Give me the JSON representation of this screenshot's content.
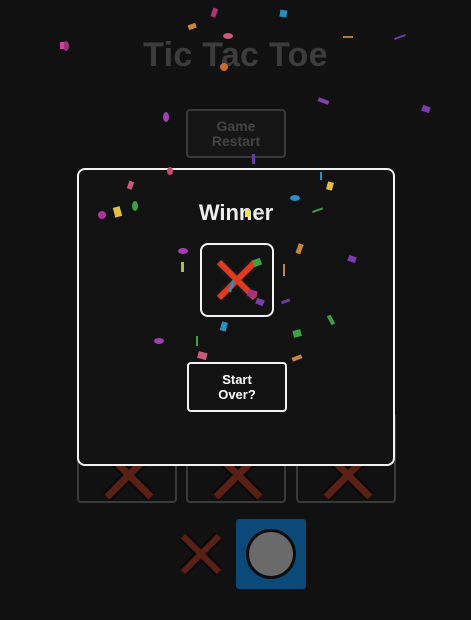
{
  "game": {
    "title": "Tic Tac Toe",
    "restart_label": "Game Restart",
    "board_bottom_row": [
      "X",
      "X",
      "X"
    ],
    "turn_indicator": {
      "x_icon": "x-mark-icon",
      "o_icon": "o-circle-icon",
      "active": "O"
    }
  },
  "modal": {
    "winner_label": "Winner",
    "winner_symbol": "X",
    "winner_icon": "x-mark-icon",
    "start_over_label": "Start Over?"
  },
  "colors": {
    "background": "#111111",
    "x_mark": "#e13a1e",
    "x_outline": "#1a1a1a",
    "x_dim": "#5a2014",
    "o_active_bg": "#0b4a78",
    "o_fill": "#6a6a6a",
    "modal_border": "#f2f2f2"
  }
}
